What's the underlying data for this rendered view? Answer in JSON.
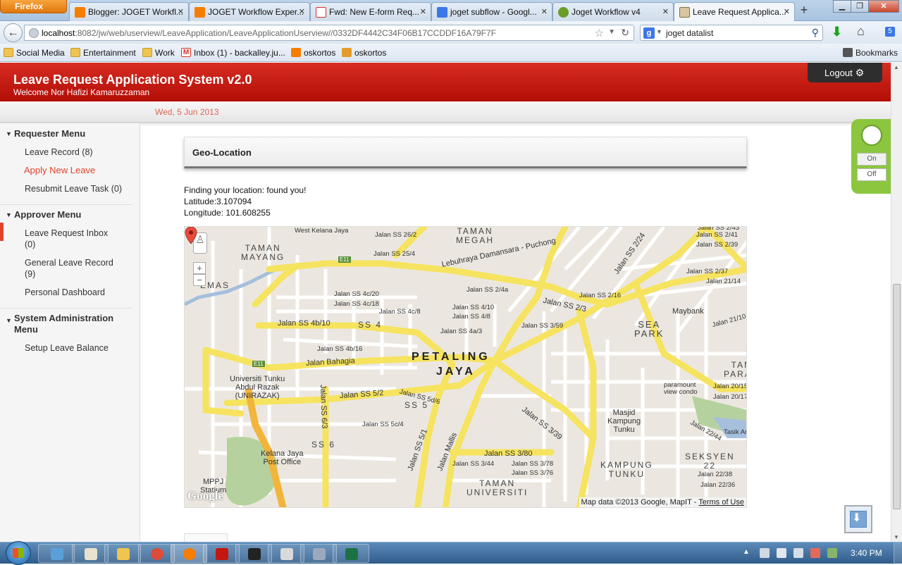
{
  "browser": {
    "menu_button": "Firefox",
    "tabs": [
      {
        "title": "Blogger: JOGET Workfl...",
        "favicon": "blogger-icon",
        "color": "#f57d00"
      },
      {
        "title": "JOGET Workflow Exper...",
        "favicon": "blogger-icon",
        "color": "#f57d00"
      },
      {
        "title": "Fwd: New E-form Req...",
        "favicon": "gmail-icon",
        "color": "#d93025"
      },
      {
        "title": "joget subflow - Googl...",
        "favicon": "google-icon",
        "color": "#3b78e7"
      },
      {
        "title": "Joget Workflow v4",
        "favicon": "joget-icon",
        "color": "#6a9d2a"
      },
      {
        "title": "Leave Request Applica...",
        "favicon": "page-icon",
        "color": "#8a6d3b"
      }
    ],
    "url_host": "localhost",
    "url_path": ":8082/jw/web/userview/LeaveApplication/LeaveApplicationUserview//0332DF4442C34F06B17CCDDF16A79F7F",
    "search_query": "joget datalist",
    "bookmarks": [
      {
        "label": "Social Media",
        "icon": "folder-icon"
      },
      {
        "label": "Entertainment",
        "icon": "folder-icon"
      },
      {
        "label": "Work",
        "icon": "folder-icon"
      },
      {
        "label": "Inbox (1) - backalley.ju...",
        "icon": "gmail-icon"
      },
      {
        "label": "oskortos",
        "icon": "blogger-icon"
      },
      {
        "label": "oskortos",
        "icon": "rss-icon"
      }
    ],
    "bookmarks_menu": "Bookmarks"
  },
  "app": {
    "title": "Leave Request Application System v2.0",
    "welcome": "Welcome Nor Hafizi Kamaruzzaman",
    "logout": "Logout",
    "date": "Wed, 5 Jun 2013",
    "brand_color": "#c4170f"
  },
  "sidebar": {
    "requester_menu": "Requester Menu",
    "leave_record": "Leave Record (8)",
    "apply_new_leave": "Apply New Leave",
    "resubmit_task": "Resubmit Leave Task (0)",
    "approver_menu": "Approver Menu",
    "leave_inbox": "Leave Request Inbox (0)",
    "general_record": "General Leave Record (9)",
    "personal_dashboard": "Personal Dashboard",
    "sysadmin_menu": "System Administration Menu",
    "setup_balance": "Setup Leave Balance"
  },
  "content": {
    "section_title": "Geo-Location",
    "status": "Finding your location: found you!",
    "latitude": "Latitude:3.107094",
    "longitude": "Longitude: 101.608255"
  },
  "map": {
    "credit": "Map data ©2013 Google, MapIT - ",
    "terms": "Terms of Use",
    "google_logo": "Google",
    "labels": {
      "petaling": "PETALING",
      "jaya": "JAYA",
      "taman_mayang": "TAMAN",
      "taman_mayang2": "MAYANG",
      "taman_megah": "TAMAN",
      "taman_megah2": "MEGAH",
      "sea_park": "SEA",
      "sea_park2": "PARK",
      "kampung_tunku": "KAMPUNG",
      "kampung_tunku2": "TUNKU",
      "taman_universiti": "TAMAN",
      "taman_universiti2": "UNIVERSITI",
      "seksyen": "SEKSYEN",
      "seksyen2": "22",
      "taman_param": "TAM",
      "taman_param2": "PARAM",
      "ss4": "SS 4",
      "ss5": "SS 5",
      "ss6": "SS 6",
      "emas": "EMAS",
      "west_kelana": "West Kelana Jaya",
      "lebuhraya": "Lebuhraya Damansara - Puchong",
      "jalan_bahagia": "Jalan Bahagia",
      "jalan_ss4b10": "Jalan SS 4b/10",
      "jalan_ss52": "Jalan SS 5/2",
      "jalan_ss23": "Jalan SS 2/3",
      "jalan_ss224": "Jalan SS 2/24",
      "jalan_ss339": "Jalan SS 3/39",
      "jalan_ss380": "Jalan SS 3/80",
      "jalan_ss63": "Jalan SS 6/3",
      "jalan_ss51": "Jalan SS 5/1",
      "jalan_mallis": "Jalan Mallis",
      "jalan_ss262": "Jalan SS 26/2",
      "jalan_ss254": "Jalan SS 25/4",
      "jalan_ss4c20": "Jalan SS 4c/20",
      "jalan_ss4c18": "Jalan SS 4c/18",
      "jalan_ss4c8": "Jalan SS 4c/8",
      "jalan_ss410": "Jalan SS 4/10",
      "jalan_ss48": "Jalan SS 4/8",
      "jalan_ss4a3": "Jalan SS 4a/3",
      "jalan_ss4b16": "Jalan SS 4b/16",
      "jalan_ss24a": "Jalan SS 2/4a",
      "jalan_ss216": "Jalan SS 2/16",
      "jalan_ss359": "Jalan SS 3/59",
      "jalan_ss5d6": "Jalan SS 5d/6",
      "jalan_ss5c4": "Jalan SS 5c/4",
      "jalan_ss344": "Jalan SS 3/44",
      "jalan_ss378": "Jalan SS 3/78",
      "jalan_ss376": "Jalan SS 3/76",
      "jalan_ss2110": "Jalan 21/10",
      "jalan_ss2015": "Jalan 20/15",
      "jalan_ss2017": "Jalan 20/17",
      "jalan_ss2244": "Jalan 22/44",
      "jalan_ss2238": "Jalan 22/38",
      "jalan_ss2236": "Jalan 22/36",
      "jalan_ss2114": "Jalan 21/14",
      "jalan_ss237": "Jalan SS 2/37",
      "jalan_ss239": "Jalan SS 2/39",
      "jalan_ss241": "Jalan SS 2/41",
      "jalan_ss243": "Jalan SS 2/43",
      "maybank": "Maybank",
      "unitar": "Universiti Tunku",
      "unitar2": "Abdul Razak",
      "unitar3": "(UNIRAZAK)",
      "kelana_post": "Kelana Jaya",
      "kelana_post2": "Post Office",
      "mppj": "MPPJ",
      "mppj2": "Statium",
      "masjid": "Masjid",
      "masjid2": "Kampung",
      "masjid3": "Tunku",
      "paramount": "paramount",
      "paramount2": "view condo",
      "tasik": "Tasik Am",
      "e11a": "E11",
      "e11b": "E11"
    }
  },
  "switcher": {
    "on": "On",
    "off": "Off"
  },
  "taskbar": {
    "clock": "3:40 PM",
    "apps": [
      {
        "name": "taskbar-app-explorer",
        "color": "#5aa0d8"
      },
      {
        "name": "taskbar-app-paint",
        "color": "#e9e2cf"
      },
      {
        "name": "taskbar-app-folder",
        "color": "#f0c450"
      },
      {
        "name": "taskbar-app-chrome",
        "color": "#dd4b39"
      },
      {
        "name": "taskbar-app-firefox",
        "color": "#f57d00"
      },
      {
        "name": "taskbar-app-acrobat",
        "color": "#c4170f"
      },
      {
        "name": "taskbar-app-cmd",
        "color": "#222222"
      },
      {
        "name": "taskbar-app-notepad",
        "color": "#d9d9d9"
      },
      {
        "name": "taskbar-app-remote",
        "color": "#9aa9bd"
      },
      {
        "name": "taskbar-app-excel",
        "color": "#1e7145"
      }
    ]
  }
}
